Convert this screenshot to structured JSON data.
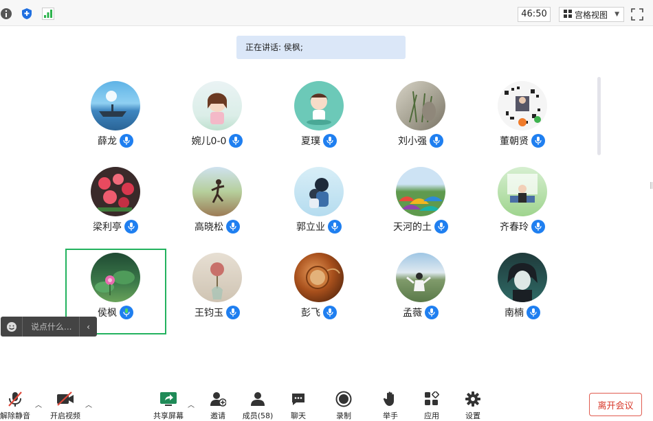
{
  "topbar": {
    "timer": "46:50",
    "view_label": "宫格视图"
  },
  "speaker": {
    "text": "正在讲话: 侯枫;"
  },
  "participants": [
    {
      "name": "薛龙"
    },
    {
      "name": "婉儿0-0"
    },
    {
      "name": "夏璞"
    },
    {
      "name": "刘小强"
    },
    {
      "name": "董朝贤"
    },
    {
      "name": "梁利亭"
    },
    {
      "name": "高晓松"
    },
    {
      "name": "郭立业"
    },
    {
      "name": "天河的土"
    },
    {
      "name": "齐春玲"
    },
    {
      "name": "侯枫"
    },
    {
      "name": "王钧玉"
    },
    {
      "name": "彭飞"
    },
    {
      "name": "孟薇"
    },
    {
      "name": "南楠"
    }
  ],
  "chat": {
    "placeholder": "说点什么..."
  },
  "toolbar": {
    "unmute": "解除静音",
    "start_video": "开启视频",
    "share_screen": "共享屏幕",
    "invite": "邀请",
    "members": "成员(58)",
    "chat": "聊天",
    "record": "录制",
    "raise_hand": "举手",
    "apps": "应用",
    "settings": "设置",
    "leave": "离开会议"
  },
  "colors": {
    "accent": "#1f7ff0",
    "active_speaker": "#22b25e",
    "leave": "#d8392b",
    "banner": "#dbe7f8"
  }
}
